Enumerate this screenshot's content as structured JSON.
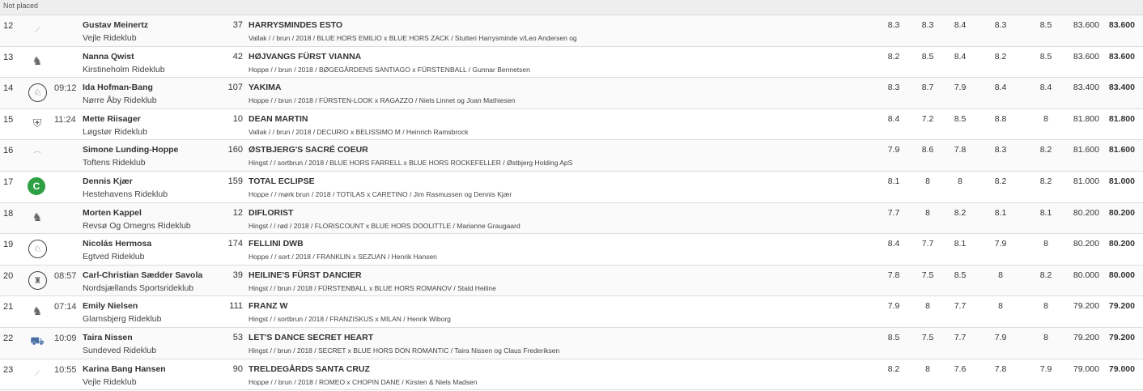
{
  "section_label": "Not placed",
  "rows": [
    {
      "rank": "12",
      "time": "",
      "rider": "Gustav Meinertz",
      "club": "Vejle Rideklub",
      "number": "37",
      "horse": "HARRYSMINDES ESTO",
      "info": "Vallak / / brun / 2018 / BLUE HORS EMILIO x BLUE HORS ZACK / Stutteri Harrysminde v/Leo Andersen og",
      "scores": [
        "8.3",
        "8.3",
        "8.4",
        "8.3",
        "8.5"
      ],
      "pct": "83.600",
      "final": "83.600",
      "logo_icon": "club-logo-icon"
    },
    {
      "rank": "13",
      "time": "",
      "rider": "Nanna Qwist",
      "club": "Kirstineholm Rideklub",
      "number": "42",
      "horse": "HØJVANGS FÜRST VIANNA",
      "info": "Hoppe / / brun / 2018 / BØGEGÅRDENS SANTIAGO x FÜRSTENBALL / Gunnar Bennetsen",
      "scores": [
        "8.2",
        "8.5",
        "8.4",
        "8.2",
        "8.5"
      ],
      "pct": "83.600",
      "final": "83.600",
      "logo_icon": "club-logo-icon"
    },
    {
      "rank": "14",
      "time": "09:12",
      "rider": "Ida Hofman-Bang",
      "club": "Nørre Åby Rideklub",
      "number": "107",
      "horse": "YAKIMA",
      "info": "Hoppe / / brun / 2018 / FÜRSTEN-LOOK x RAGAZZO / Niels Linnet og Joan Mathiesen",
      "scores": [
        "8.3",
        "8.7",
        "7.9",
        "8.4",
        "8.4"
      ],
      "pct": "83.400",
      "final": "83.400",
      "logo_icon": "club-logo-icon"
    },
    {
      "rank": "15",
      "time": "11:24",
      "rider": "Mette Riisager",
      "club": "Løgstør Rideklub",
      "number": "10",
      "horse": "DEAN MARTIN",
      "info": "Vallak / / brun / 2018 / DECURIO x BELISSIMO M / Heinrich Ramsbrock",
      "scores": [
        "8.4",
        "7.2",
        "8.5",
        "8.8",
        "8"
      ],
      "pct": "81.800",
      "final": "81.800",
      "logo_icon": "club-logo-icon"
    },
    {
      "rank": "16",
      "time": "",
      "rider": "Simone Lunding-Hoppe",
      "club": "Toftens Rideklub",
      "number": "160",
      "horse": "ØSTBJERG'S SACRÉ COEUR",
      "info": "Hingst / / sortbrun / 2018 / BLUE HORS FARRELL x BLUE HORS ROCKEFELLER / Østbjerg Holding ApS",
      "scores": [
        "7.9",
        "8.6",
        "7.8",
        "8.3",
        "8.2"
      ],
      "pct": "81.600",
      "final": "81.600",
      "logo_icon": "club-logo-icon"
    },
    {
      "rank": "17",
      "time": "",
      "rider": "Dennis Kjær",
      "club": "Hestehavens Rideklub",
      "number": "159",
      "horse": "TOTAL ECLIPSE",
      "info": "Hoppe / / mørk brun / 2018 / TOTILAS x CARETINO / Jim Rasmussen og Dennis Kjær",
      "scores": [
        "8.1",
        "8",
        "8",
        "8.2",
        "8.2"
      ],
      "pct": "81.000",
      "final": "81.000",
      "logo_icon": "club-logo-icon"
    },
    {
      "rank": "18",
      "time": "",
      "rider": "Morten Kappel",
      "club": "Revsø Og Omegns Rideklub",
      "number": "12",
      "horse": "DIFLORIST",
      "info": "Hingst / / rød / 2018 / FLORISCOUNT x BLUE HORS DOOLITTLE / Marianne Graugaard",
      "scores": [
        "7.7",
        "8",
        "8.2",
        "8.1",
        "8.1"
      ],
      "pct": "80.200",
      "final": "80.200",
      "logo_icon": "club-logo-icon"
    },
    {
      "rank": "19",
      "time": "",
      "rider": "Nicolás Hermosa",
      "club": "Egtved Rideklub",
      "number": "174",
      "horse": "FELLINI DWB",
      "info": "Hoppe / / sort / 2018 / FRANKLIN x SEZUAN / Henrik Hansen",
      "scores": [
        "8.4",
        "7.7",
        "8.1",
        "7.9",
        "8"
      ],
      "pct": "80.200",
      "final": "80.200",
      "logo_icon": "club-logo-icon"
    },
    {
      "rank": "20",
      "time": "08:57",
      "rider": "Carl-Christian Sædder Savola",
      "club": "Nordsjællands Sportsrideklub",
      "number": "39",
      "horse": "HEILINE'S FÜRST DANCIER",
      "info": "Hingst / / brun / 2018 / FÜRSTENBALL x BLUE HORS ROMANOV / Stald Heiline",
      "scores": [
        "7.8",
        "7.5",
        "8.5",
        "8",
        "8.2"
      ],
      "pct": "80.000",
      "final": "80.000",
      "logo_icon": "club-logo-icon"
    },
    {
      "rank": "21",
      "time": "07:14",
      "rider": "Emily Nielsen",
      "club": "Glamsbjerg Rideklub",
      "number": "111",
      "horse": "FRANZ W",
      "info": "Hingst / / sortbrun / 2018 / FRANZISKUS x MILAN / Henrik Wiborg",
      "scores": [
        "7.9",
        "8",
        "7.7",
        "8",
        "8"
      ],
      "pct": "79.200",
      "final": "79.200",
      "logo_icon": "club-logo-icon"
    },
    {
      "rank": "22",
      "time": "10:09",
      "rider": "Taira Nissen",
      "club": "Sundeved Rideklub",
      "number": "53",
      "horse": "LET'S DANCE SECRET HEART",
      "info": "Hingst / / brun / 2018 / SECRET x BLUE HORS DON ROMANTIC / Taira Nissen og Claus Frederiksen",
      "scores": [
        "8.5",
        "7.5",
        "7.7",
        "7.9",
        "8"
      ],
      "pct": "79.200",
      "final": "79.200",
      "logo_icon": "club-logo-icon"
    },
    {
      "rank": "23",
      "time": "10:55",
      "rider": "Karina Bang Hansen",
      "club": "Vejle Rideklub",
      "number": "90",
      "horse": "TRELDEGÅRDS SANTA CRUZ",
      "info": "Hoppe / / brun / 2018 / ROMEO x CHOPIN DANE / Kirsten & Niels Madsen",
      "scores": [
        "8.2",
        "8",
        "7.6",
        "7.8",
        "7.9"
      ],
      "pct": "79.000",
      "final": "79.000",
      "logo_icon": "club-logo-icon"
    }
  ]
}
